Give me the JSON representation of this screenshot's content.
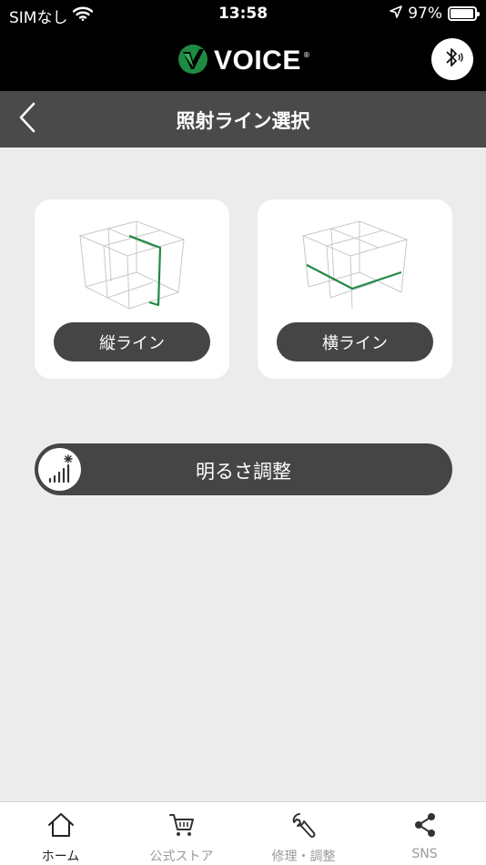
{
  "status_bar": {
    "carrier": "SIMなし",
    "time": "13:58",
    "battery_percent": "97%",
    "battery_level": 0.97
  },
  "brand": {
    "logo_text": "VOICE",
    "logo_mark": "®"
  },
  "header": {
    "title": "照射ライン選択"
  },
  "cards": [
    {
      "label": "縦ライン",
      "icon": "vertical-line-cube-icon"
    },
    {
      "label": "横ライン",
      "icon": "horizontal-line-cube-icon"
    }
  ],
  "brightness": {
    "label": "明るさ調整",
    "icon": "brightness-signal-icon"
  },
  "tabs": [
    {
      "label": "ホーム",
      "icon": "home-icon",
      "active": true
    },
    {
      "label": "公式ストア",
      "icon": "cart-icon",
      "active": false
    },
    {
      "label": "修理・調整",
      "icon": "wrench-icon",
      "active": false
    },
    {
      "label": "SNS",
      "icon": "share-icon",
      "active": false
    }
  ],
  "colors": {
    "accent_green": "#1f8a43",
    "bar_dark": "#4a4a4a",
    "pill_dark": "#454545",
    "background": "#ececec"
  }
}
